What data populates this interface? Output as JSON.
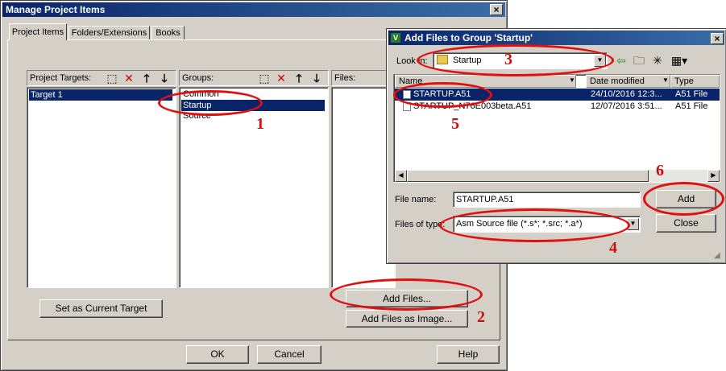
{
  "manage": {
    "title": "Manage Project Items",
    "close": "×",
    "tabs": [
      "Project Items",
      "Folders/Extensions",
      "Books"
    ],
    "targets_label": "Project Targets:",
    "targets": [
      "Target 1"
    ],
    "groups_label": "Groups:",
    "groups": [
      "Common",
      "Startup",
      "Source"
    ],
    "files_label": "Files:",
    "set_current": "Set as Current Target",
    "add_files": "Add Files...",
    "add_image": "Add Files as Image...",
    "ok": "OK",
    "cancel": "Cancel",
    "help": "Help"
  },
  "add": {
    "title": "Add Files to Group 'Startup'",
    "close": "×",
    "look_in_label": "Look in:",
    "look_in_value": "Startup",
    "columns": [
      "Name",
      "Date modified",
      "Type"
    ],
    "files": [
      {
        "name": "STARTUP.A51",
        "date": "24/10/2016 12:3...",
        "type": "A51 File"
      },
      {
        "name": "STARTUP_N76E003beta.A51",
        "date": "12/07/2016 3:51...",
        "type": "A51 File"
      }
    ],
    "file_name_label": "File name:",
    "file_name_value": "STARTUP.A51",
    "files_of_type_label": "Files of type:",
    "files_of_type_value": "Asm Source file (*.s*; *.src; *.a*)",
    "add_btn": "Add",
    "close_btn": "Close"
  },
  "annotations": [
    "1",
    "2",
    "3",
    "4",
    "5",
    "6"
  ],
  "colors": {
    "annotation": "#e01010",
    "title_bar": "#0a246a",
    "selection": "#0a246a",
    "dialog": "#d4d0c8"
  },
  "icons": [
    "new-item-icon",
    "delete-icon",
    "move-up-icon",
    "move-down-icon",
    "folder-icon",
    "back-icon",
    "up-folder-icon",
    "new-folder-icon",
    "view-menu-icon",
    "file-icon",
    "dropdown-icon",
    "close-icon"
  ]
}
